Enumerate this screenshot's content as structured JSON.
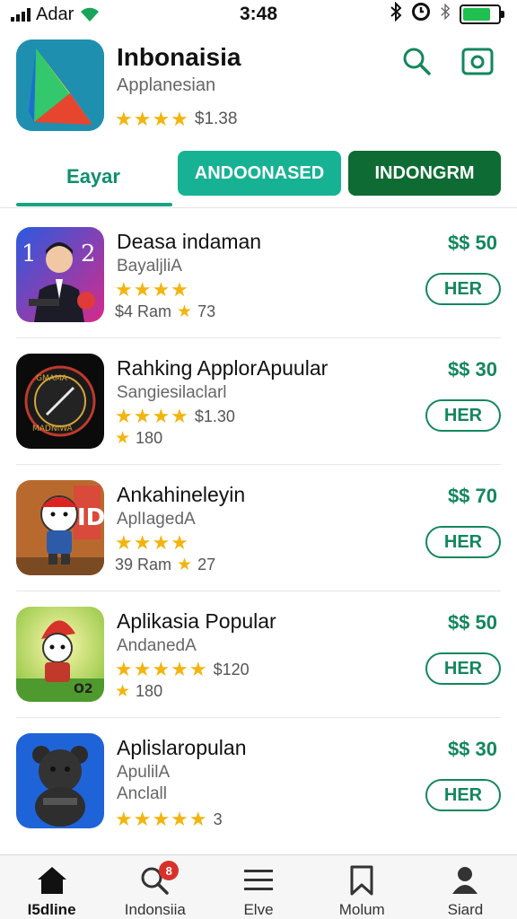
{
  "status_bar": {
    "carrier": "Adar",
    "time": "3:48",
    "battery_color": "#1fbf50"
  },
  "header": {
    "title": "Inbonaisia",
    "subtitle": "Applanesian",
    "stars": "★★★★",
    "price": "$1.38",
    "search_icon": "search-icon",
    "camera_icon": "camera-icon"
  },
  "tabs": {
    "active_label": "Eayar",
    "pill_1": "ANDOONASED",
    "pill_2": "INDONGRM",
    "accent": "#19a384"
  },
  "apps": [
    {
      "title": "Deasa indaman",
      "subtitle": "BayaljliA",
      "stars": "★★★★",
      "rating_text": "",
      "meta_size": "$4 Ram",
      "meta_score": "73",
      "price": "$$ 50",
      "button": "HER",
      "icon": "portrait-icon"
    },
    {
      "title": "Rahking ApplorApuular",
      "subtitle": "Sangiesilaclarl",
      "stars": "★★★★",
      "rating_text": "$1.30",
      "meta_size": "",
      "meta_score": "180",
      "price": "$$ 30",
      "button": "HER",
      "icon": "dial-icon"
    },
    {
      "title": "Ankahineleyin",
      "subtitle": "AplIagedA",
      "stars": "★★★★",
      "rating_text": "",
      "meta_size": "39 Ram",
      "meta_score": "27",
      "price": "$$ 70",
      "button": "HER",
      "icon": "bear-cartoon-icon"
    },
    {
      "title": "Aplikasia Popular",
      "subtitle": "AndanedA",
      "stars": "★★★★★",
      "rating_text": "$120",
      "meta_size": "",
      "meta_score": "180",
      "price": "$$ 50",
      "button": "HER",
      "icon": "gnome-cartoon-icon"
    },
    {
      "title": "Aplislaropulan",
      "subtitle": "ApulilA",
      "subtitle2": "Anclall",
      "stars": "★★★★★",
      "rating_text": "3",
      "price": "$$ 30",
      "button": "HER",
      "icon": "dark-bear-icon"
    }
  ],
  "bottom_nav": [
    {
      "label": "I5dline",
      "icon": "home-icon"
    },
    {
      "label": "Indonsiia",
      "icon": "search-icon",
      "badge": "8"
    },
    {
      "label": "Elve",
      "icon": "menu-icon"
    },
    {
      "label": "Molum",
      "icon": "bookmark-icon"
    },
    {
      "label": "Siard",
      "icon": "person-icon"
    }
  ]
}
